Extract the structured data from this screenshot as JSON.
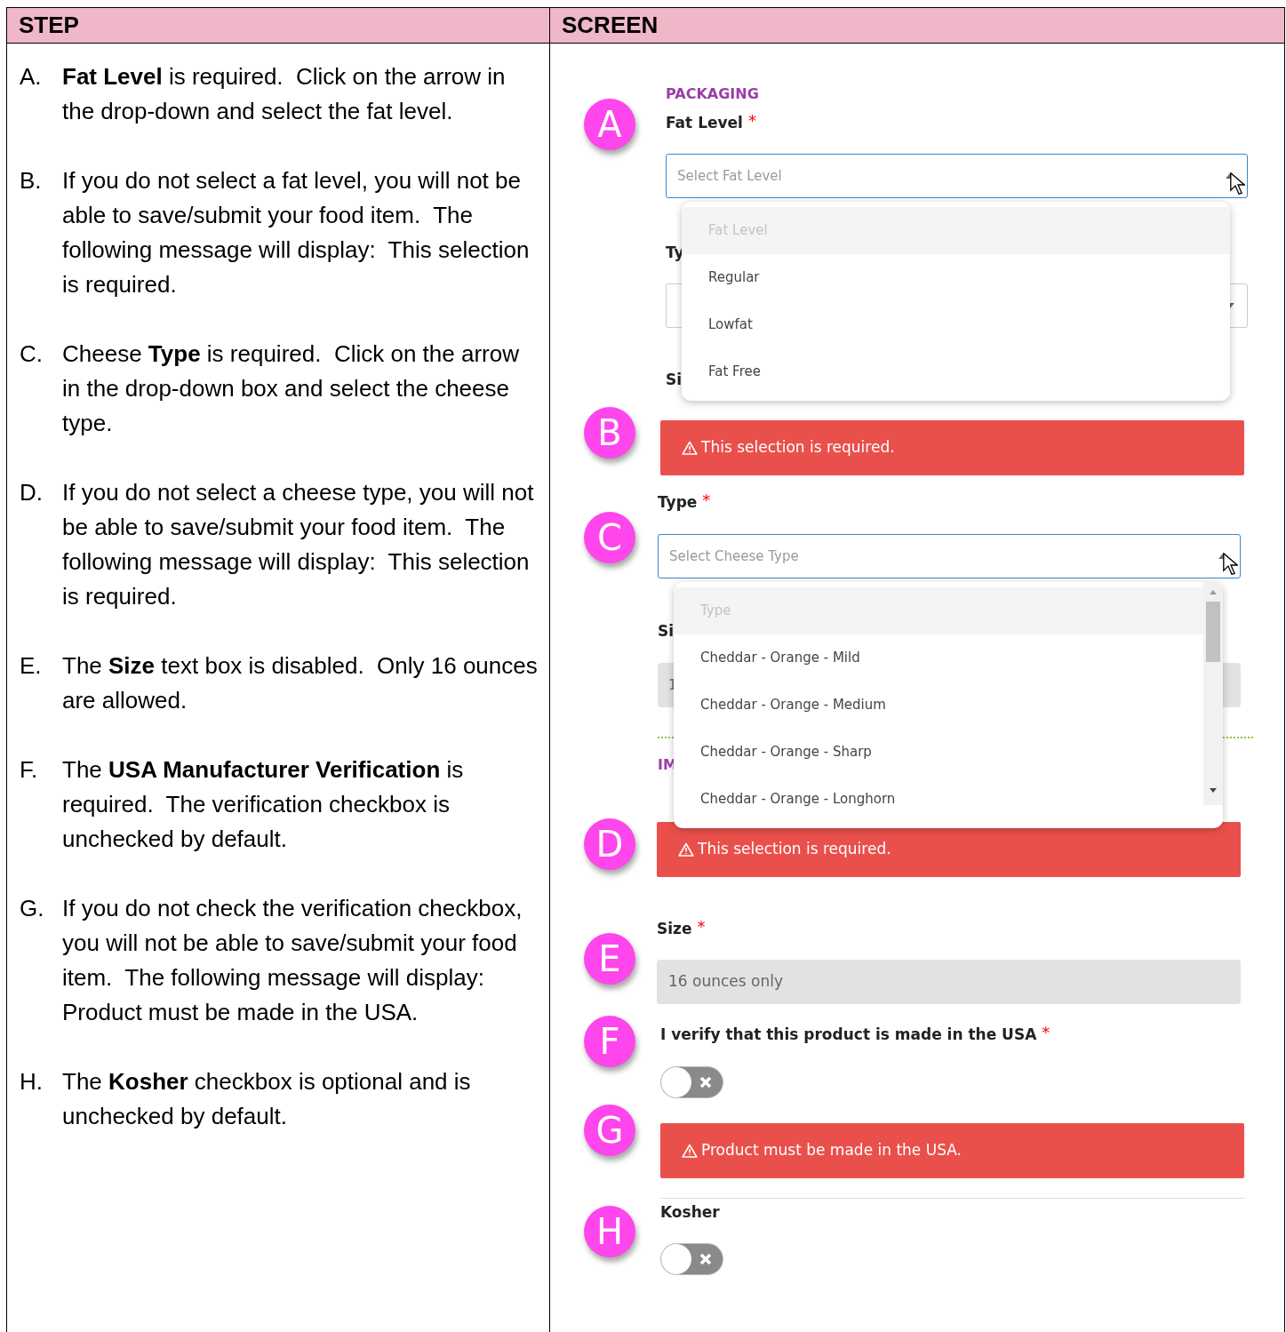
{
  "columns": [
    "STEP",
    "SCREEN"
  ],
  "steps": [
    {
      "marker": "A.",
      "text": "**Fat Level** is required.  Click on the arrow in the drop-down and select the fat level."
    },
    {
      "marker": "B.",
      "text": "If you do not select a fat level, you will not be able to save/submit your food item.  The following message will display:  This selection is required."
    },
    {
      "marker": "C.",
      "text": "Cheese **Type** is required.  Click on the arrow in the drop-down box and select the cheese type."
    },
    {
      "marker": "D.",
      "text": "If you do not select a cheese type, you will not be able to save/submit your food item.  The following message will display:  This selection is required."
    },
    {
      "marker": "E.",
      "text": "The **Size** text box is disabled.  Only 16 ounces are allowed."
    },
    {
      "marker": "F.",
      "text": "The **USA Manufacturer Verification** is required.  The verification checkbox is unchecked by default."
    },
    {
      "marker": "G.",
      "text": "If you do not check the verification checkbox, you will not be able to save/submit your food item.  The following message will display:  Product must be made in the USA."
    },
    {
      "marker": "H.",
      "text": "The **Kosher** checkbox is optional and is unchecked by default."
    }
  ],
  "screen": {
    "section_title": "PACKAGING",
    "fat_level": {
      "badge": "A",
      "label": "Fat Level",
      "asterisk": "*",
      "placeholder": "Select Fat Level",
      "expanded": true,
      "options": [
        {
          "label": "Fat Level",
          "disabled": true
        },
        {
          "label": "Regular",
          "disabled": false
        },
        {
          "label": "Lowfat",
          "disabled": false
        },
        {
          "label": "Fat Free",
          "disabled": false
        }
      ],
      "behind": {
        "type_label": "Ty",
        "size_label": "Si"
      }
    },
    "fat_error": {
      "badge": "B",
      "message": "This selection is required."
    },
    "type": {
      "badge": "C",
      "label": "Type",
      "asterisk": "*",
      "placeholder": "Select Cheese Type",
      "expanded": true,
      "options": [
        {
          "label": "Type",
          "disabled": true
        },
        {
          "label": "Cheddar - Orange - Mild",
          "disabled": false
        },
        {
          "label": "Cheddar - Orange - Medium",
          "disabled": false
        },
        {
          "label": "Cheddar - Orange - Sharp",
          "disabled": false
        },
        {
          "label": "Cheddar - Orange - Longhorn",
          "disabled": false
        }
      ],
      "behind": {
        "size_label": "Si",
        "size_field": "1",
        "section_title": "IM"
      }
    },
    "type_error": {
      "badge": "D",
      "message": "This selection is required."
    },
    "size": {
      "badge": "E",
      "label": "Size",
      "asterisk": "*",
      "value": "16 ounces only",
      "disabled": true
    },
    "usa": {
      "badge": "F",
      "label": "I verify that this product is made in the USA",
      "asterisk": "*",
      "on": false
    },
    "usa_error": {
      "badge": "G",
      "message": "Product must be made in the USA."
    },
    "kosher": {
      "badge": "H",
      "label": "Kosher",
      "on": false
    }
  }
}
